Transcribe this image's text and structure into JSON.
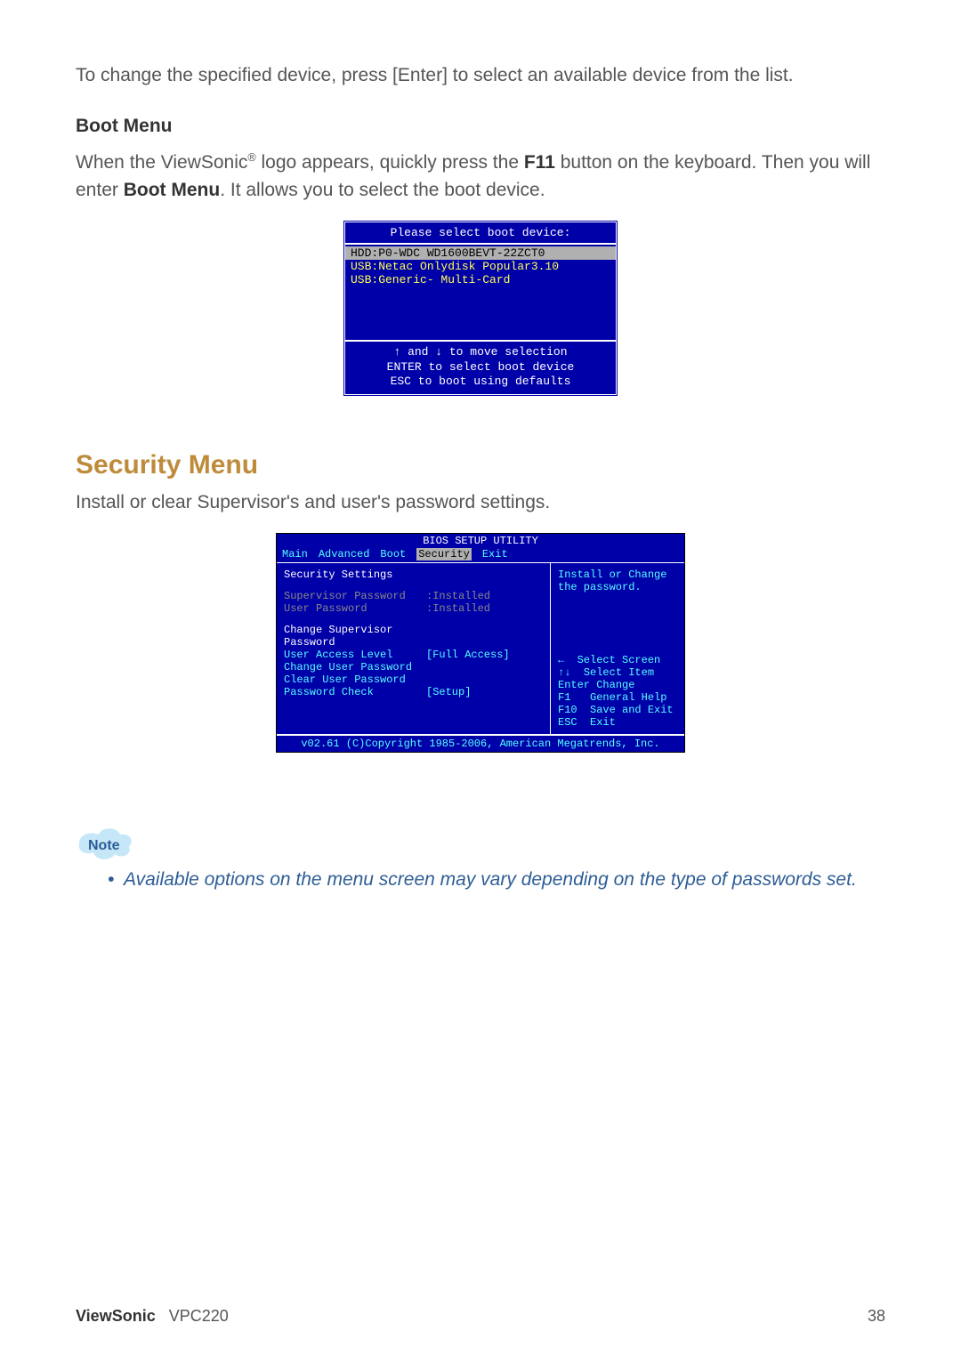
{
  "intro": {
    "line": "To change the specified device, press [Enter] to select an available device from the list."
  },
  "boot_section": {
    "heading": "Boot Menu",
    "para_parts": {
      "a": "When the ViewSonic",
      "reg": "®",
      "b": " logo appears, quickly press the ",
      "f11": "F11",
      "c": " button on the keyboard. Then you will enter ",
      "bootmenu": "Boot Menu",
      "d": ". It allows you to select the boot device."
    }
  },
  "boot_box": {
    "title": "Please select boot device:",
    "items": [
      "HDD:P0-WDC WD1600BEVT-22ZCT0",
      "USB:Netac Onlydisk Popular3.10",
      "USB:Generic- Multi-Card"
    ],
    "selected_index": 0,
    "help": "↑ and ↓ to move selection\nENTER to select boot device\nESC to boot using defaults"
  },
  "security_section": {
    "heading": "Security Menu",
    "para": "Install or clear Supervisor's and user's password settings."
  },
  "bios": {
    "header": "BIOS SETUP UTILITY",
    "tabs": [
      "Main",
      "Advanced",
      "Boot",
      "Security",
      "Exit"
    ],
    "active_tab": "Security",
    "left": {
      "title": "Security Settings",
      "status": [
        {
          "label": "Supervisor Password",
          "value": ":Installed"
        },
        {
          "label": "User Password",
          "value": ":Installed"
        }
      ],
      "options": [
        {
          "label": "Change Supervisor Password",
          "value": ""
        },
        {
          "label": "User Access Level",
          "value": "[Full Access]"
        },
        {
          "label": "Change User Password",
          "value": ""
        },
        {
          "label": "Clear User Password",
          "value": ""
        },
        {
          "label": "Password Check",
          "value": "[Setup]"
        }
      ]
    },
    "right": {
      "help": "Install or Change the password.",
      "keys": [
        {
          "k": "←",
          "t": "Select Screen"
        },
        {
          "k": "↑↓",
          "t": "Select Item"
        },
        {
          "k": "Enter",
          "t": "Change"
        },
        {
          "k": "F1",
          "t": "General Help"
        },
        {
          "k": "F10",
          "t": "Save and Exit"
        },
        {
          "k": "ESC",
          "t": "Exit"
        }
      ]
    },
    "footer": "v02.61 (C)Copyright 1985-2006, American Megatrends, Inc."
  },
  "note": {
    "label": "Note",
    "bullet": "Available options on the menu screen may vary depending on the type of passwords set."
  },
  "footer": {
    "brand": "ViewSonic",
    "model": "VPC220",
    "page": "38"
  }
}
